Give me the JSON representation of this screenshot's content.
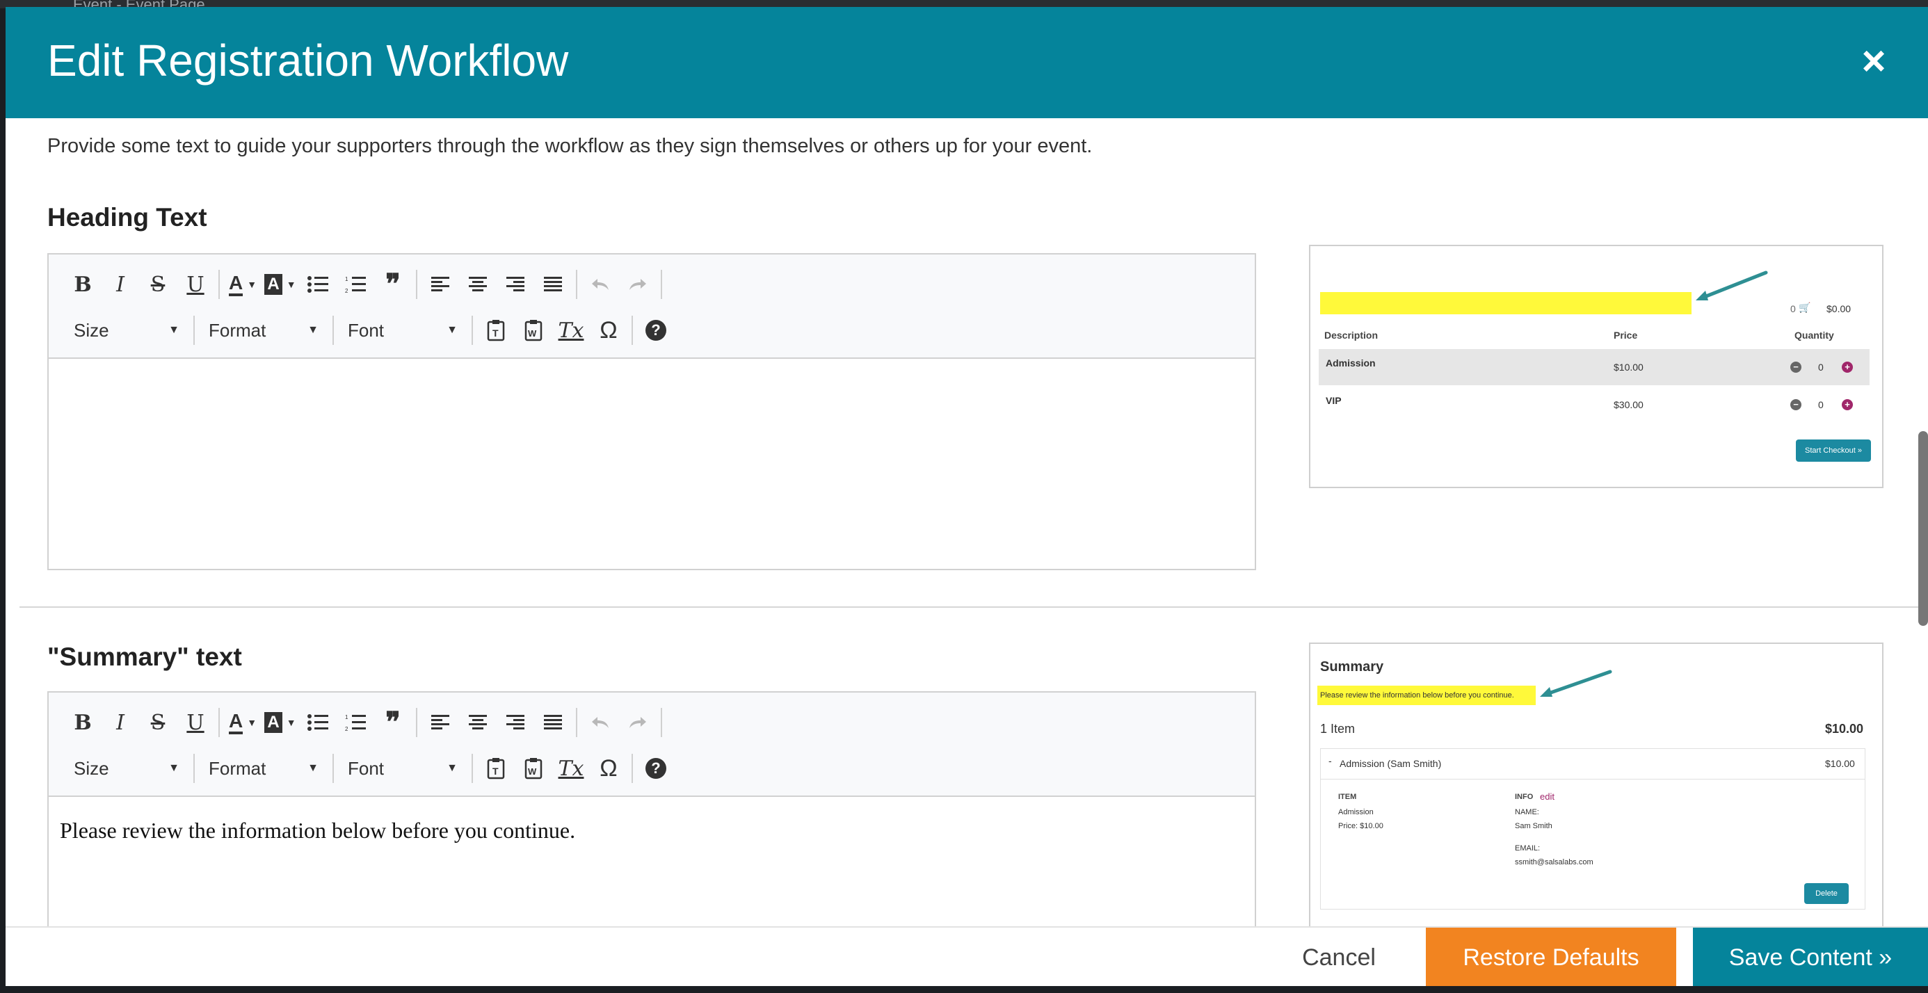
{
  "background": {
    "page_label": "Event - Event Page"
  },
  "modal": {
    "title": "Edit Registration Workflow",
    "close_glyph": "×",
    "intro": "Provide some text to guide your supporters through the workflow as they sign themselves or others up for your event."
  },
  "toolbar": {
    "bold": "B",
    "italic": "I",
    "strike": "S",
    "underline": "U",
    "font_color": "A",
    "bg_color": "A",
    "blockquote": "❞",
    "size_label": "Size",
    "format_label": "Format",
    "font_label": "Font",
    "special_char": "Ω",
    "help": "?",
    "clear_format": "Tx"
  },
  "sections": [
    {
      "title": "Heading Text",
      "content": "",
      "preview": {
        "cart_count": "0",
        "cart_total": "$0.00",
        "headers": {
          "description": "Description",
          "price": "Price",
          "quantity": "Quantity"
        },
        "rows": [
          {
            "name": "Admission",
            "price": "$10.00",
            "qty": "0"
          },
          {
            "name": "VIP",
            "price": "$30.00",
            "qty": "0"
          }
        ],
        "checkout_label": "Start Checkout »"
      }
    },
    {
      "title": "\"Summary\" text",
      "content": "Please review the information below before you continue.",
      "preview": {
        "heading": "Summary",
        "highlight_text": "Please review the information below before you continue.",
        "items_label": "1 Item",
        "items_total": "$10.00",
        "line_item": "Admission (Sam Smith)",
        "line_price": "$10.00",
        "item_head": "ITEM",
        "item_name": "Admission",
        "item_price": "Price: $10.00",
        "info_head": "INFO",
        "info_edit": "edit",
        "name_label": "NAME:",
        "name_value": "Sam Smith",
        "email_label": "EMAIL:",
        "email_value": "ssmith@salsalabs.com",
        "delete_label": "Delete"
      }
    }
  ],
  "footer": {
    "cancel": "Cancel",
    "restore": "Restore Defaults",
    "save": "Save Content »"
  },
  "colors": {
    "header": "#05849b",
    "restore": "#f28420",
    "save": "#05849b",
    "highlight": "#fff93a"
  }
}
